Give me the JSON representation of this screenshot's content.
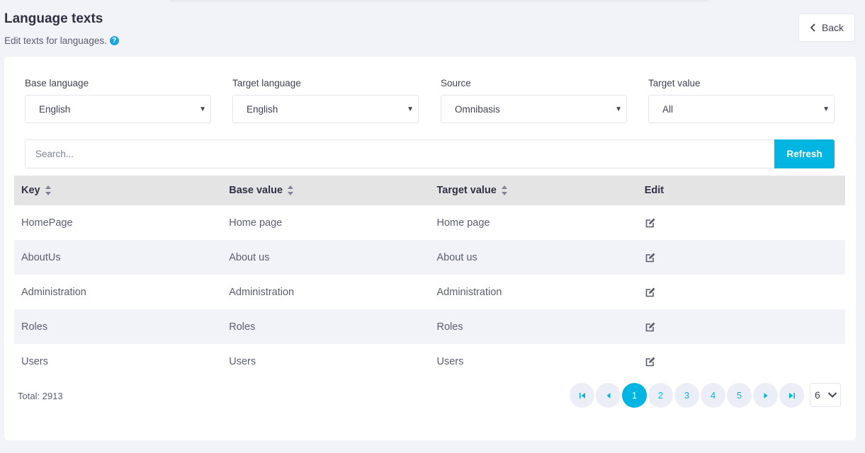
{
  "header": {
    "title": "Language texts",
    "subtitle": "Edit texts for languages.",
    "back_label": "Back"
  },
  "filters": [
    {
      "label": "Base language",
      "value": "English"
    },
    {
      "label": "Target language",
      "value": "English"
    },
    {
      "label": "Source",
      "value": "Omnibasis"
    },
    {
      "label": "Target value",
      "value": "All"
    }
  ],
  "search": {
    "placeholder": "Search...",
    "value": "",
    "refresh_label": "Refresh"
  },
  "table": {
    "columns": [
      "Key",
      "Base value",
      "Target value",
      "Edit"
    ],
    "rows": [
      {
        "key": "HomePage",
        "base": "Home page",
        "target": "Home page"
      },
      {
        "key": "AboutUs",
        "base": "About us",
        "target": "About us"
      },
      {
        "key": "Administration",
        "base": "Administration",
        "target": "Administration"
      },
      {
        "key": "Roles",
        "base": "Roles",
        "target": "Roles"
      },
      {
        "key": "Users",
        "base": "Users",
        "target": "Users"
      }
    ]
  },
  "footer": {
    "total_text": "Total: 2913",
    "pages": [
      "1",
      "2",
      "3",
      "4",
      "5"
    ],
    "current_page": "1",
    "page_size": "6"
  },
  "colors": {
    "accent": "#00b5e2",
    "header_bg": "#e4e4e4",
    "row_alt_bg": "#f2f3f8"
  }
}
